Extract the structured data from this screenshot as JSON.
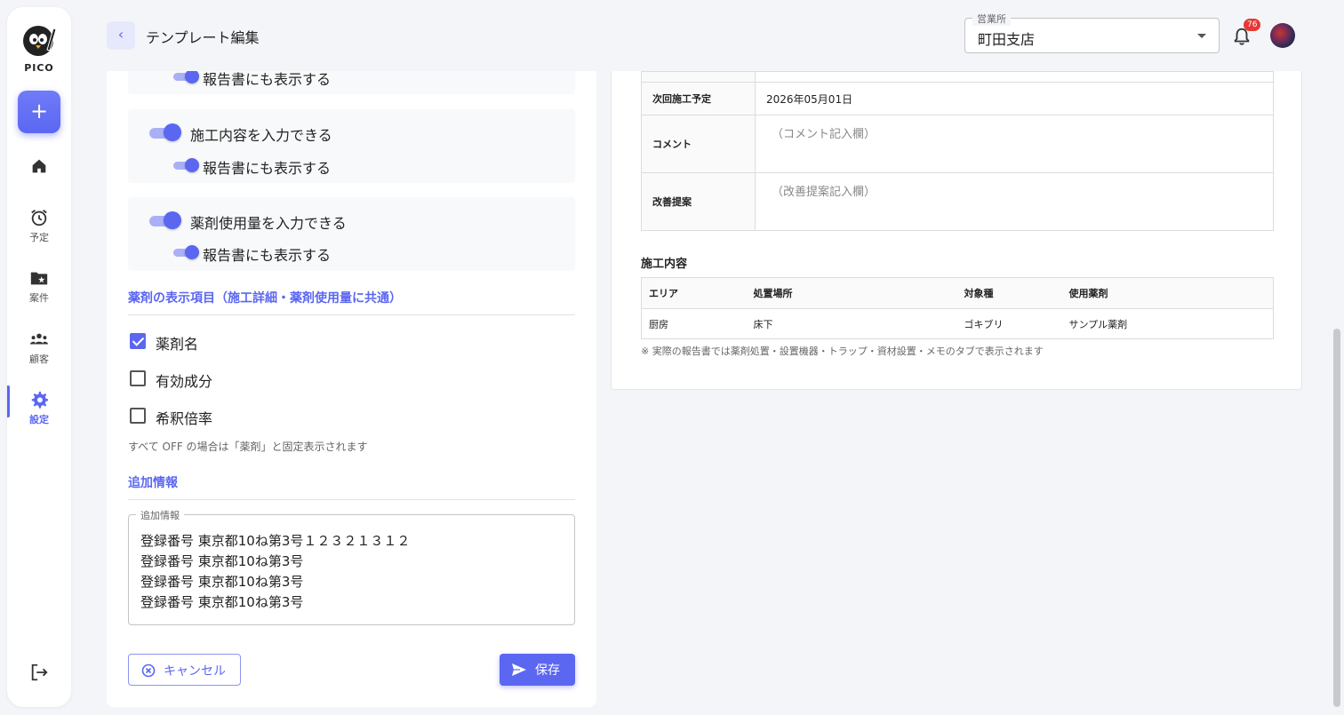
{
  "app": {
    "logo_text": "PICO"
  },
  "sidebar": {
    "add_label": "+",
    "items": [
      {
        "key": "home",
        "label": ""
      },
      {
        "key": "schedule",
        "label": "予定"
      },
      {
        "key": "projects",
        "label": "案件"
      },
      {
        "key": "customers",
        "label": "顧客"
      },
      {
        "key": "settings",
        "label": "設定",
        "active": true
      }
    ]
  },
  "header": {
    "title": "テンプレート編集",
    "office": {
      "legend": "営業所",
      "value": "町田支店"
    },
    "notification_count": "76"
  },
  "form": {
    "options": [
      {
        "label": "",
        "sub_label": "報告書にも表示する",
        "sub_on": true
      },
      {
        "label": "施工内容を入力できる",
        "on": true,
        "sub_label": "報告書にも表示する",
        "sub_on": true
      },
      {
        "label": "薬剤使用量を入力できる",
        "on": true,
        "sub_label": "報告書にも表示する",
        "sub_on": true
      }
    ],
    "chemical_section": {
      "heading": "薬剤の表示項目（施工詳細・薬剤使用量に共通）",
      "items": [
        {
          "label": "薬剤名",
          "checked": true
        },
        {
          "label": "有効成分",
          "checked": false
        },
        {
          "label": "希釈倍率",
          "checked": false
        }
      ],
      "hint": "すべて OFF の場合は「薬剤」と固定表示されます"
    },
    "extra_section": {
      "heading": "追加情報",
      "legend": "追加情報",
      "lines": [
        "登録番号 東京都10ね第3号１２３２１３１２",
        "登録番号 東京都10ね第3号",
        "登録番号 東京都10ね第3号",
        "登録番号 東京都10ね第3号"
      ]
    },
    "cancel_label": "キャンセル",
    "save_label": "保存"
  },
  "preview": {
    "rows": [
      {
        "label": "",
        "value": ""
      },
      {
        "label": "次回施工予定",
        "value": "2026年05月01日"
      },
      {
        "label": "コメント",
        "value": "（コメント記入欄）"
      },
      {
        "label": "改善提案",
        "value": "（改善提案記入欄）"
      }
    ],
    "work_heading": "施工内容",
    "work_table": {
      "headers": [
        "エリア",
        "処置場所",
        "対象種",
        "使用薬剤"
      ],
      "rows": [
        [
          "厨房",
          "床下",
          "ゴキブリ",
          "サンプル薬剤"
        ]
      ]
    },
    "note": "※ 実際の報告書では薬剤処置・設置機器・トラップ・資材設置・メモのタブで表示されます"
  },
  "colors": {
    "accent": "#5b67f1",
    "badge": "#e53935"
  }
}
